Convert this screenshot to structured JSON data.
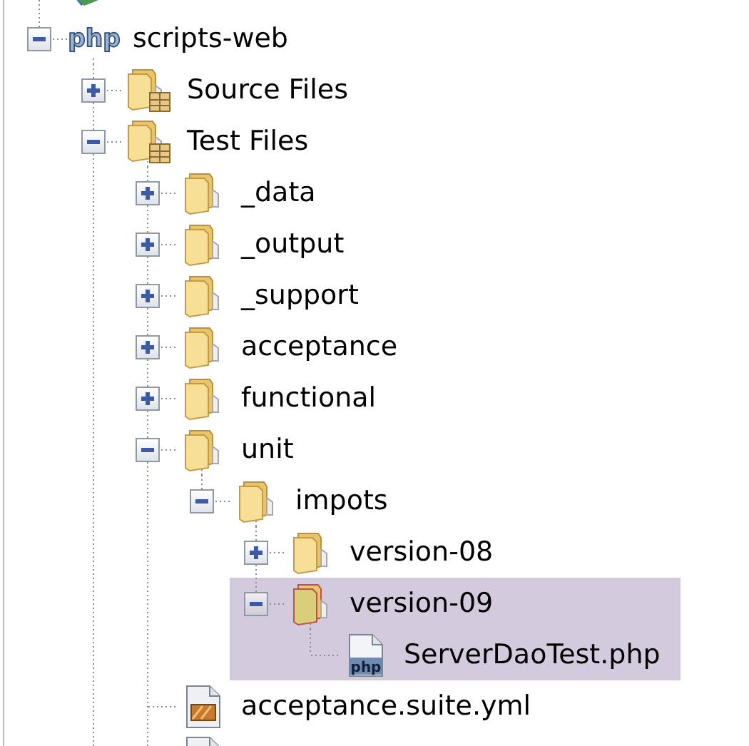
{
  "tree": [
    {
      "kind": "project-other",
      "selected": false
    },
    {
      "kind": "project",
      "label": "scripts-web",
      "icon_text": "php",
      "expanded": true,
      "selected": false,
      "children": [
        {
          "kind": "source-folder",
          "label": "Source Files",
          "expanded": false,
          "selected": false
        },
        {
          "kind": "source-folder",
          "label": "Test Files",
          "expanded": true,
          "selected": false,
          "continues": true,
          "children": [
            {
              "kind": "folder",
              "label": "_data",
              "expanded": false,
              "selected": false
            },
            {
              "kind": "folder",
              "label": "_output",
              "expanded": false,
              "selected": false
            },
            {
              "kind": "folder",
              "label": "_support",
              "expanded": false,
              "selected": false
            },
            {
              "kind": "folder",
              "label": "acceptance",
              "expanded": false,
              "selected": false
            },
            {
              "kind": "folder",
              "label": "functional",
              "expanded": false,
              "selected": false
            },
            {
              "kind": "folder",
              "label": "unit",
              "expanded": true,
              "selected": false,
              "children": [
                {
                  "kind": "folder",
                  "label": "impots",
                  "expanded": true,
                  "selected": false,
                  "children": [
                    {
                      "kind": "folder",
                      "label": "version-08",
                      "expanded": false,
                      "error": false,
                      "selected": false
                    },
                    {
                      "kind": "folder",
                      "label": "version-09",
                      "expanded": true,
                      "error": true,
                      "selected": true,
                      "children": [
                        {
                          "kind": "php-file",
                          "label": "ServerDaoTest.php",
                          "icon_text": "php",
                          "selected": true
                        }
                      ]
                    }
                  ]
                }
              ]
            },
            {
              "kind": "yml-file",
              "label": "acceptance.suite.yml",
              "selected": false
            },
            {
              "kind": "yml-file",
              "selected": false
            }
          ]
        }
      ]
    }
  ]
}
